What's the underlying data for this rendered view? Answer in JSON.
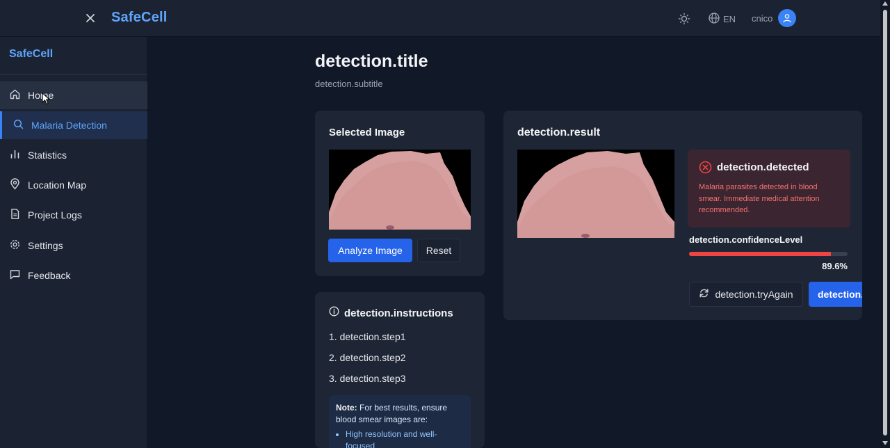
{
  "header": {
    "brand": "SafeCell",
    "language": "EN",
    "username": "cnico"
  },
  "sidebar": {
    "brand": "SafeCell",
    "items": [
      {
        "label": "Home",
        "icon": "home-icon",
        "state": "hover"
      },
      {
        "label": "Malaria Detection",
        "icon": "search-icon",
        "state": "active"
      },
      {
        "label": "Statistics",
        "icon": "bar-chart-icon",
        "state": ""
      },
      {
        "label": "Location Map",
        "icon": "map-pin-icon",
        "state": ""
      },
      {
        "label": "Project Logs",
        "icon": "document-icon",
        "state": ""
      },
      {
        "label": "Settings",
        "icon": "gear-icon",
        "state": ""
      },
      {
        "label": "Feedback",
        "icon": "message-icon",
        "state": ""
      }
    ]
  },
  "page": {
    "title": "detection.title",
    "subtitle": "detection.subtitle"
  },
  "upload": {
    "title": "Selected Image",
    "analyze_label": "Analyze Image",
    "reset_label": "Reset"
  },
  "result": {
    "title": "detection.result",
    "alert_title": "detection.detected",
    "alert_text": "Malaria parasites detected in blood smear. Immediate medical attention recommended.",
    "confidence_label": "detection.confidenceLevel",
    "confidence_value": "89.6%",
    "confidence_fraction": 0.896,
    "try_again_label": "detection.tryAgain",
    "second_button_label": "detection."
  },
  "instructions": {
    "title": "detection.instructions",
    "steps": [
      "1. detection.step1",
      "2. detection.step2",
      "3. detection.step3"
    ],
    "note_label": "Note:",
    "note_text": "For best results, ensure blood smear images are:",
    "note_bullets": [
      "High resolution and well-focused"
    ]
  },
  "colors": {
    "accent": "#3b82f6",
    "brand": "#60a5fa",
    "danger": "#ef4444",
    "background": "#111827",
    "panel": "#1e2635"
  }
}
